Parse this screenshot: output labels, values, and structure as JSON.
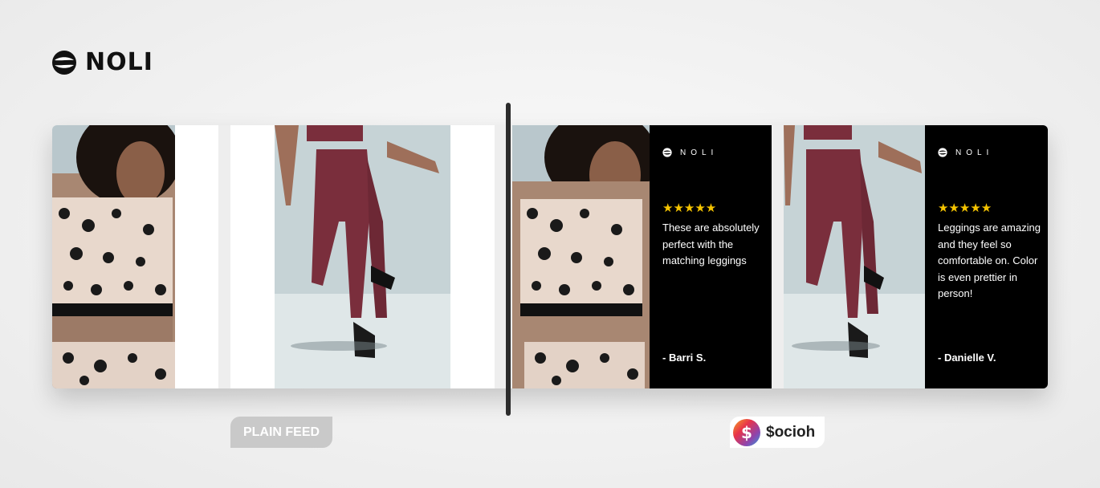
{
  "brand": {
    "name": "NOLI",
    "mini_name": "NOLI"
  },
  "plain_feed": {
    "label": "PLAIN FEED"
  },
  "socioh": {
    "label": "$ocioh",
    "icon_glyph": "$"
  },
  "reviews": [
    {
      "rating": 5,
      "stars": "★★★★★",
      "text": "These are absolutely perfect with the matching leggings",
      "author": "- Barri S."
    },
    {
      "rating": 5,
      "stars": "★★★★★",
      "text": "Leggings are amazing and they feel so comfortable on. Color is even prettier in person!",
      "author": "- Danielle V."
    }
  ],
  "colors": {
    "review_bg": "#000000",
    "star": "#f5c400",
    "plain_badge": "#c9c9c9",
    "legging": "#7a2e3c"
  },
  "images": [
    {
      "name": "leopard-top-model-photo"
    },
    {
      "name": "burgundy-leggings-model-photo"
    }
  ]
}
